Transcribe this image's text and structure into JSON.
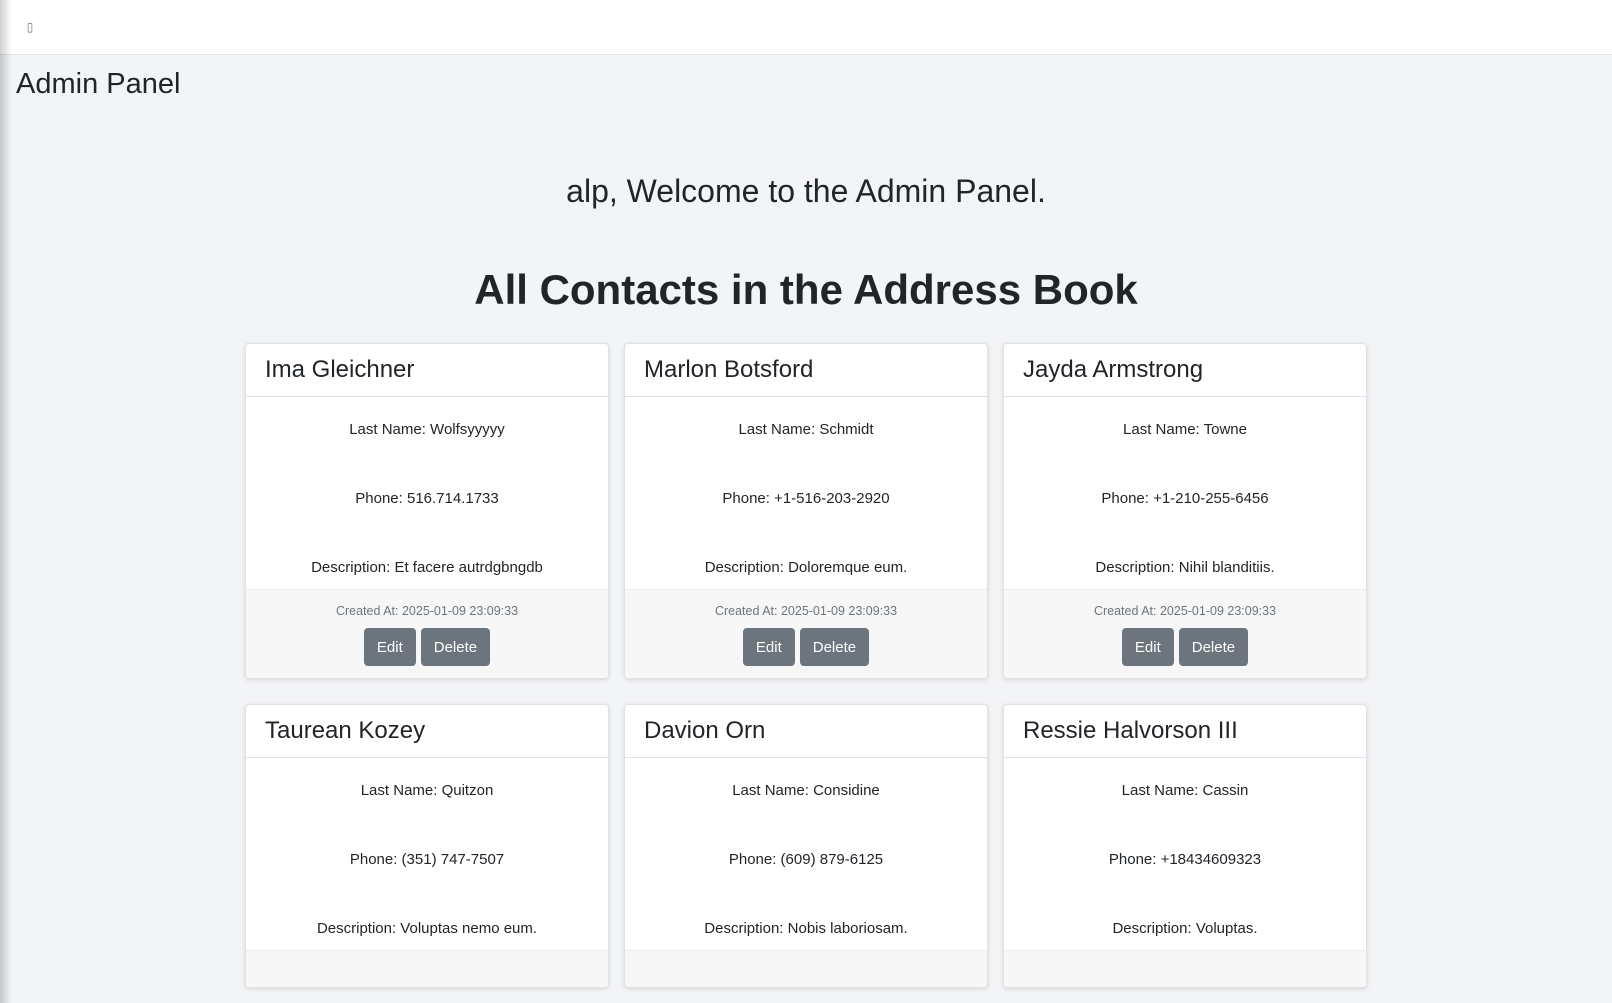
{
  "topbar": {
    "menu_icon": "menu-toggle-icon",
    "menu_glyph": "▯"
  },
  "brand": "Admin Panel",
  "welcome": "alp, Welcome to the Admin Panel.",
  "section_title": "All Contacts in the Address Book",
  "labels": {
    "edit": "Edit",
    "delete": "Delete"
  },
  "contacts": [
    {
      "name": "Ima Gleichner",
      "last_name": "Last Name: Wolfsyyyyy",
      "phone": "Phone: 516.714.1733",
      "description": "Description: Et facere autrdgbngdb",
      "created": "Created At: 2025-01-09 23:09:33"
    },
    {
      "name": "Marlon Botsford",
      "last_name": "Last Name: Schmidt",
      "phone": "Phone: +1-516-203-2920",
      "description": "Description: Doloremque eum.",
      "created": "Created At: 2025-01-09 23:09:33"
    },
    {
      "name": "Jayda Armstrong",
      "last_name": "Last Name: Towne",
      "phone": "Phone: +1-210-255-6456",
      "description": "Description: Nihil blanditiis.",
      "created": "Created At: 2025-01-09 23:09:33"
    },
    {
      "name": "Taurean Kozey",
      "last_name": "Last Name: Quitzon",
      "phone": "Phone: (351) 747-7507",
      "description": "Description: Voluptas nemo eum.",
      "created": ""
    },
    {
      "name": "Davion Orn",
      "last_name": "Last Name: Considine",
      "phone": "Phone: (609) 879-6125",
      "description": "Description: Nobis laboriosam.",
      "created": ""
    },
    {
      "name": "Ressie Halvorson III",
      "last_name": "Last Name: Cassin",
      "phone": "Phone: +18434609323",
      "description": "Description: Voluptas.",
      "created": ""
    }
  ],
  "colors": {
    "background": "#f3f4f6",
    "button": "#6c757d",
    "card": "#ffffff",
    "footer": "#f7f7f7"
  }
}
